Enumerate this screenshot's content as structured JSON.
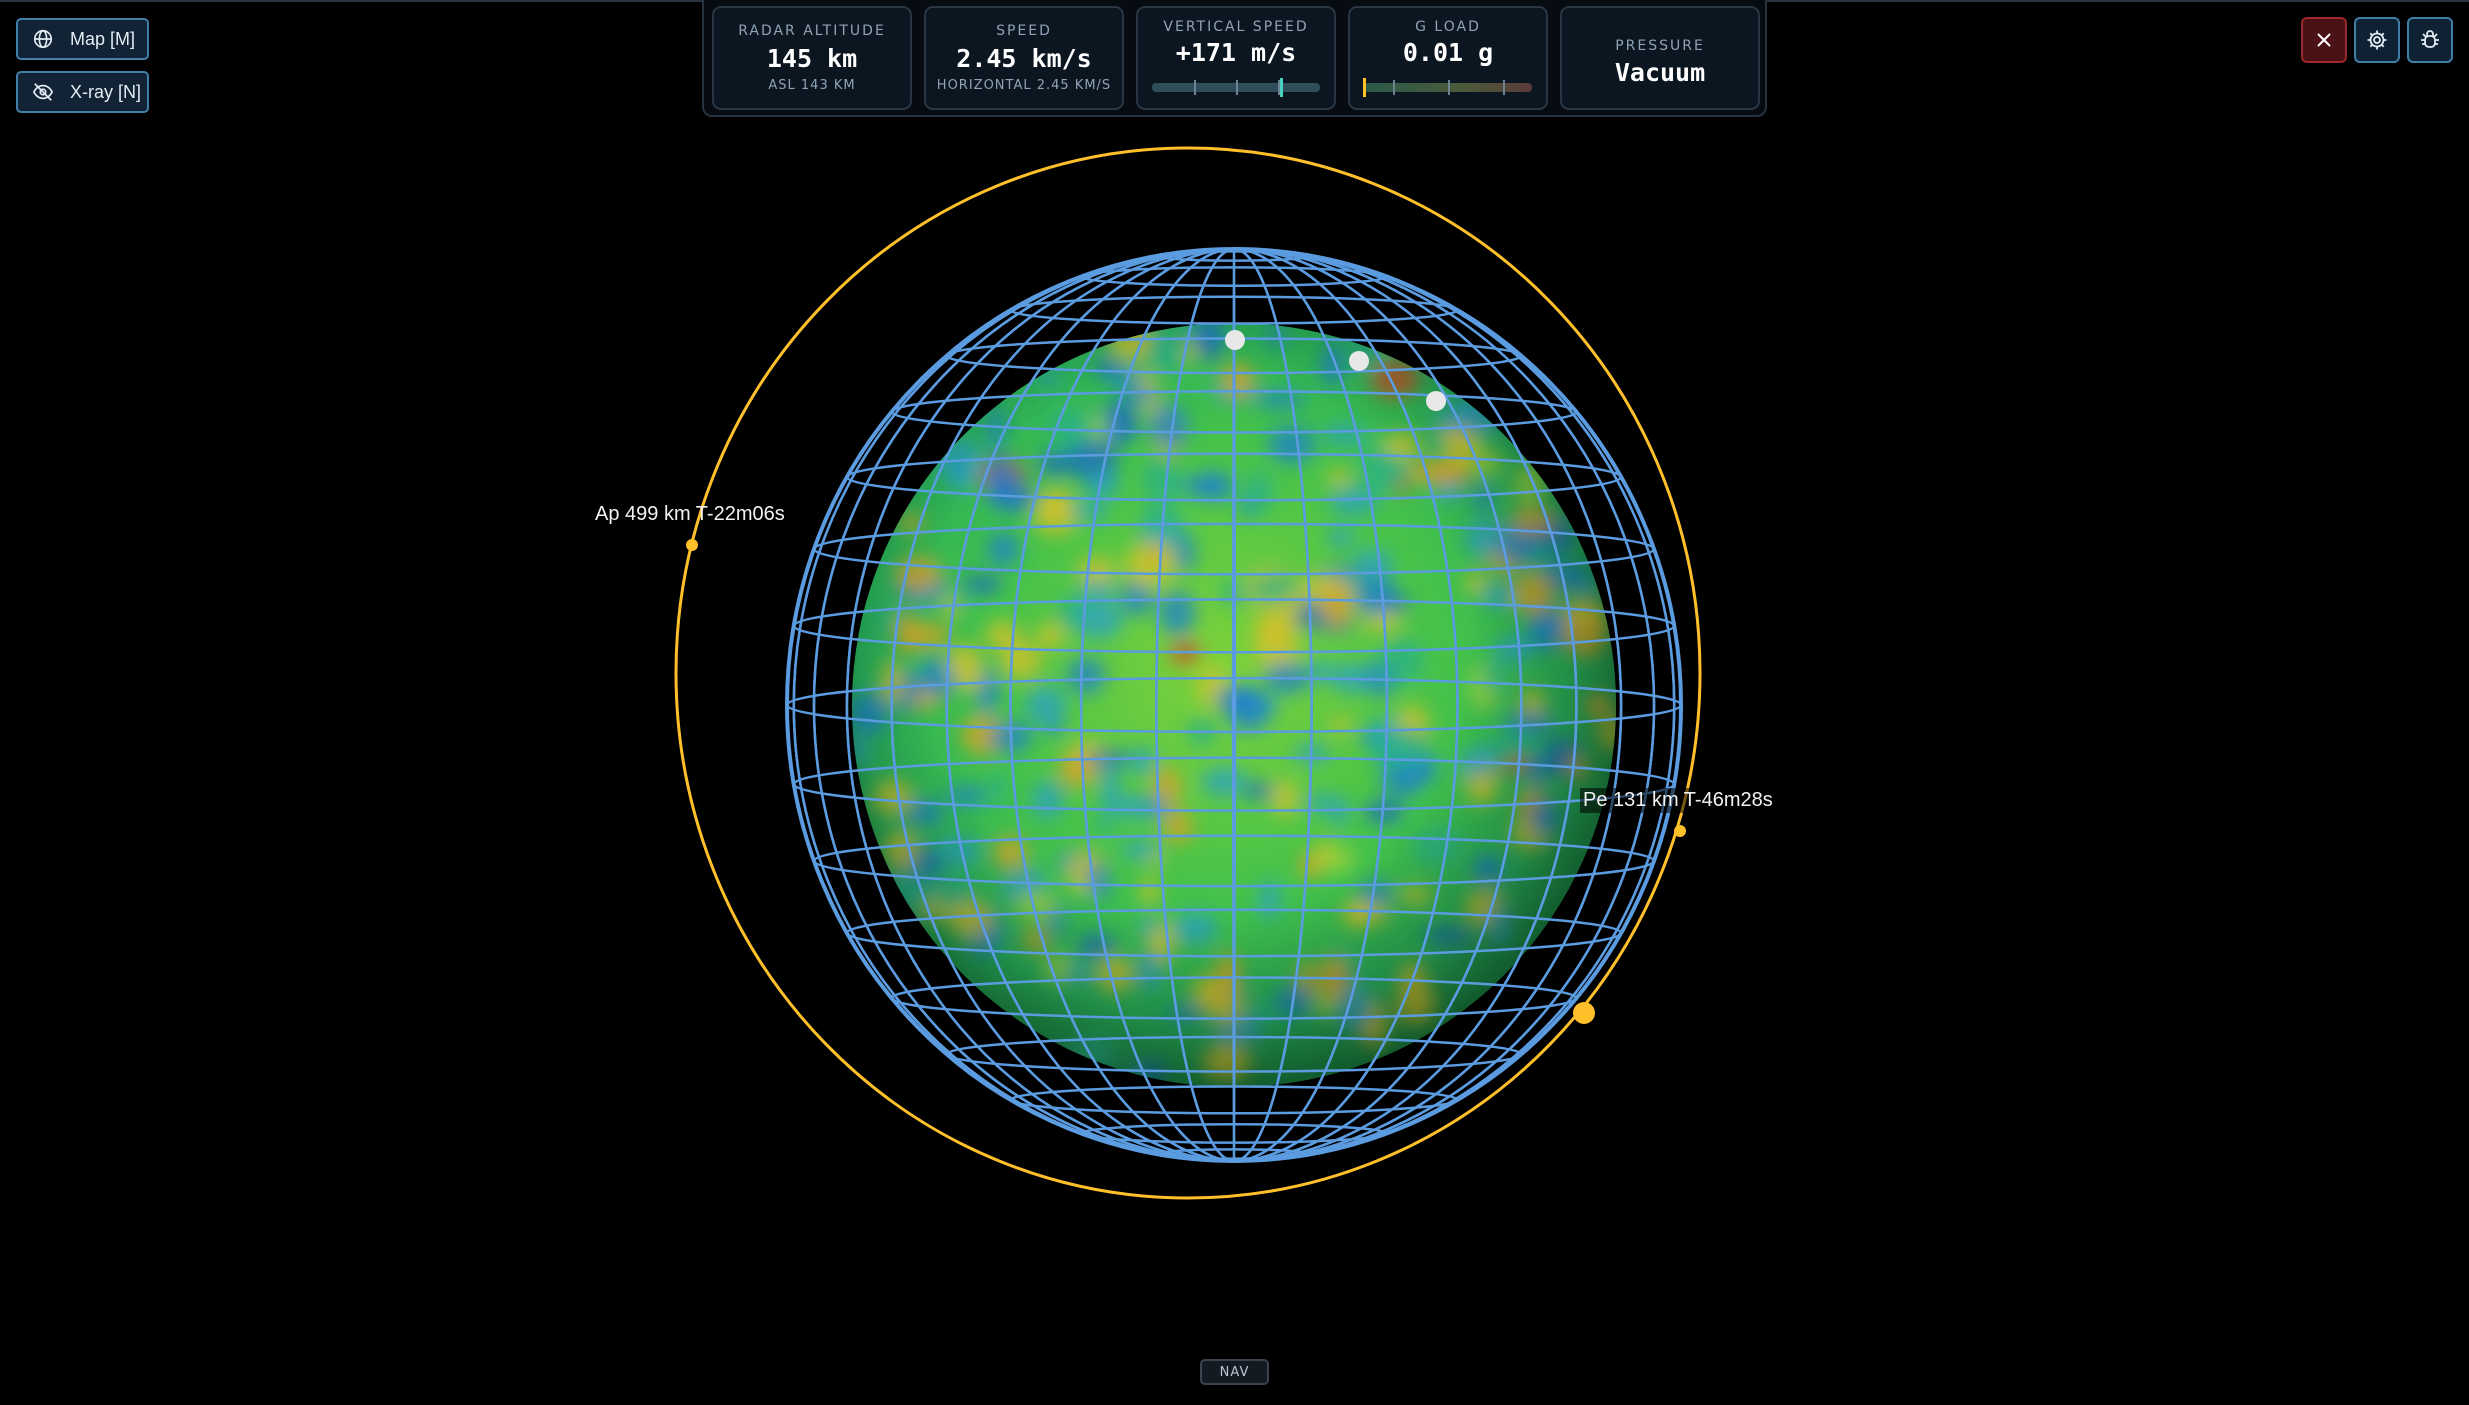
{
  "view_toggles": {
    "map_label": "Map [M]",
    "map_icon": "globe-icon",
    "xray_label": "X-ray [N]",
    "xray_icon": "eye-off-icon"
  },
  "hud": {
    "radar_altitude": {
      "label": "RADAR ALTITUDE",
      "value": "145 km",
      "sub": "ASL 143 KM"
    },
    "speed": {
      "label": "SPEED",
      "value": "2.45 km/s",
      "sub": "HORIZONTAL 2.45 KM/S"
    },
    "vertical_speed": {
      "label": "VERTICAL SPEED",
      "value": "+171 m/s",
      "needle_fraction": 0.77
    },
    "g_load": {
      "label": "G LOAD",
      "value": "0.01 g",
      "needle_fraction": 0.0
    },
    "pressure": {
      "label": "PRESSURE",
      "value": "Vacuum"
    }
  },
  "toolbar": {
    "close_icon": "close-icon",
    "settings_icon": "gear-icon",
    "debug_icon": "bug-icon"
  },
  "orbit": {
    "apoapsis_label": "Ap 499 km T-22m06s",
    "periapsis_label": "Pe 131 km T-46m28s"
  },
  "colors": {
    "orbit": "#ffc02a",
    "wireframe": "#5b9be0",
    "accent": "#3f7fa8",
    "danger": "#9a2a2e"
  },
  "nav": {
    "label": "NAV"
  }
}
